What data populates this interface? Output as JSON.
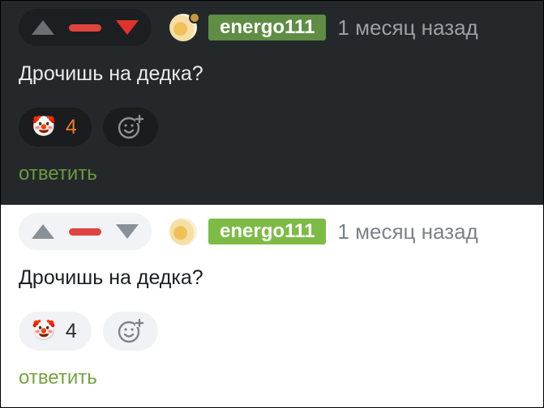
{
  "comments": [
    {
      "theme": "dark",
      "username": "energo111",
      "time": "1 месяц назад",
      "text": "Дрочишь на дедка?",
      "reaction_emoji": "🤡",
      "reaction_count": "4",
      "reply_label": "ответить",
      "icons": {
        "upvote": "triangle-up-icon",
        "downvote": "triangle-down-icon",
        "add_reaction": "smiley-plus-icon"
      },
      "colors": {
        "badge": "#5e8d43",
        "downvote_active": "#e3322c",
        "count": "#f07a28"
      }
    },
    {
      "theme": "light",
      "username": "energo111",
      "time": "1 месяц назад",
      "text": "Дрочишь на дедка?",
      "reaction_emoji": "🤡",
      "reaction_count": "4",
      "reply_label": "ответить",
      "icons": {
        "upvote": "triangle-up-icon",
        "downvote": "triangle-down-icon",
        "add_reaction": "smiley-plus-icon"
      },
      "colors": {
        "badge": "#7ebb46",
        "rating_dash": "#e0443f",
        "reply": "#72a53f"
      }
    }
  ]
}
